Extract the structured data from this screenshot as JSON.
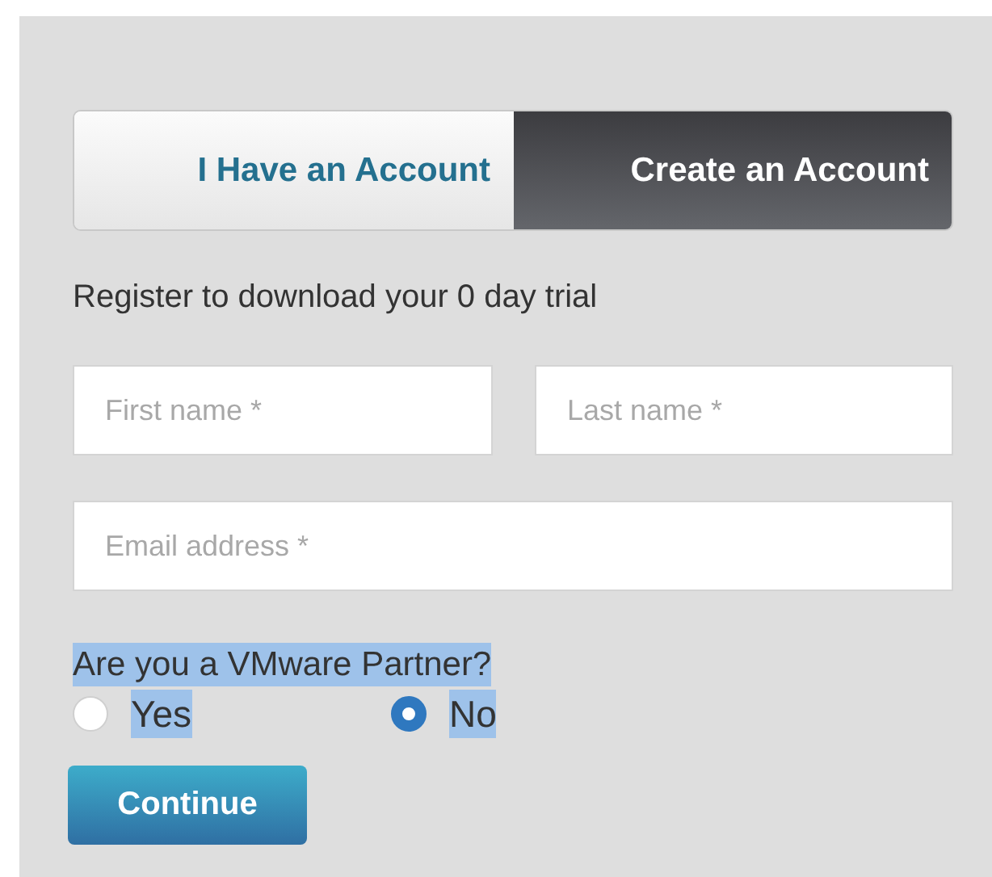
{
  "tabs": [
    {
      "label": "I Have an Account",
      "selected": false
    },
    {
      "label": "Create an Account",
      "selected": true
    }
  ],
  "heading": "Register to download your 0 day trial",
  "fields": [
    {
      "placeholder": "First name *"
    },
    {
      "placeholder": "Last name *"
    },
    {
      "placeholder": "Email address *"
    }
  ],
  "partner_question": {
    "label": "Are you a VMware Partner?",
    "highlighted": true,
    "options": [
      {
        "label": "Yes",
        "selected": false,
        "highlighted": true
      },
      {
        "label": "No",
        "selected": true,
        "highlighted": true
      }
    ]
  },
  "buttons": [
    "Continue"
  ]
}
